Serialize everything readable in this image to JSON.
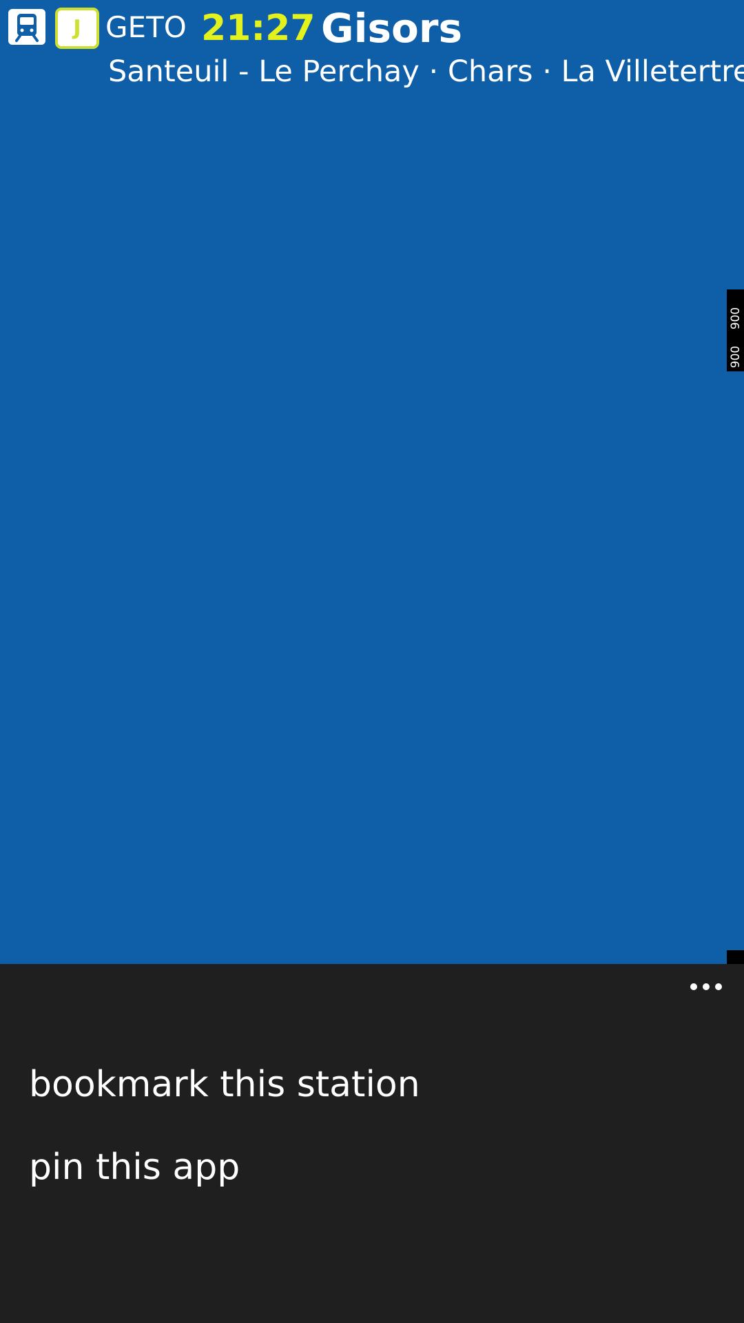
{
  "header": {
    "line_badge": "J",
    "code": "GETO",
    "time": "21:27",
    "destination": "Gisors",
    "stops": "Santeuil - Le Perchay · Chars · La Villetertre · L"
  },
  "side_tab": {
    "label_top": "900",
    "label_bottom": "900"
  },
  "app_bar": {
    "items": [
      {
        "label": "bookmark this station"
      },
      {
        "label": "pin this app"
      }
    ]
  },
  "colors": {
    "background": "#0f5ea8",
    "time": "#e3f21c",
    "line_badge": "#cde02f",
    "app_bar": "#1f1f1f"
  },
  "icons": {
    "train": "train-icon",
    "more": "more-icon"
  }
}
